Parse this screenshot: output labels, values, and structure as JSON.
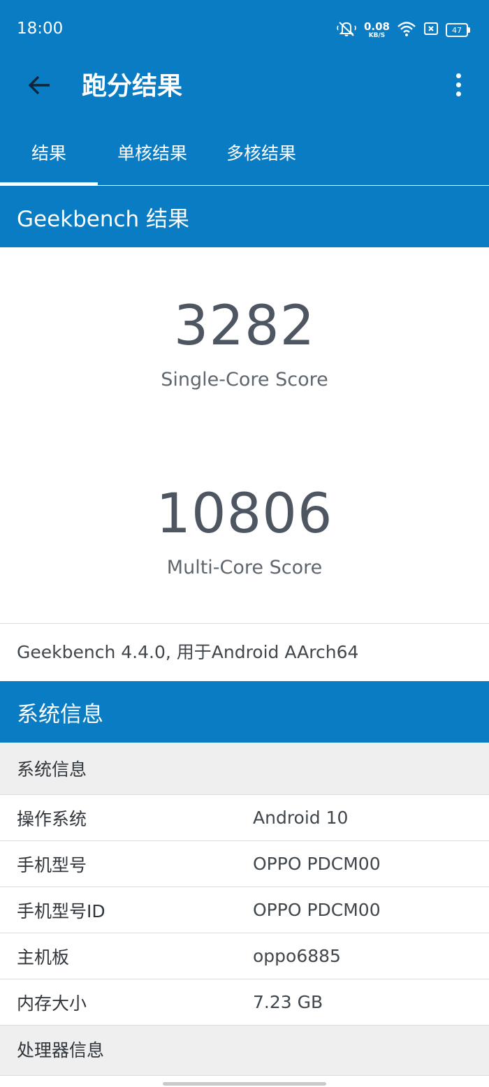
{
  "status_bar": {
    "time": "18:00",
    "net_speed_value": "0.08",
    "net_speed_unit": "KB/S",
    "battery": "47",
    "icons": [
      "mute-bell-icon",
      "wifi-icon",
      "sim-card-icon",
      "battery-icon"
    ]
  },
  "app_bar": {
    "title": "跑分结果",
    "back_icon": "back-arrow-icon",
    "menu_icon": "more-vertical-icon"
  },
  "tabs": [
    {
      "label": "结果",
      "selected": true
    },
    {
      "label": "单核结果",
      "selected": false
    },
    {
      "label": "多核结果",
      "selected": false
    }
  ],
  "geekbench": {
    "header": "Geekbench 结果",
    "single_score": "3282",
    "single_label": "Single-Core Score",
    "multi_score": "10806",
    "multi_label": "Multi-Core Score",
    "version": "Geekbench 4.4.0, 用于Android AArch64"
  },
  "system": {
    "header": "系统信息",
    "subheader": "系统信息",
    "rows": [
      {
        "key": "操作系统",
        "value": "Android 10"
      },
      {
        "key": "手机型号",
        "value": "OPPO PDCM00"
      },
      {
        "key": "手机型号ID",
        "value": "OPPO PDCM00"
      },
      {
        "key": "主机板",
        "value": "oppo6885"
      },
      {
        "key": "内存大小",
        "value": "7.23 GB"
      }
    ],
    "processor_header": "处理器信息"
  },
  "colors": {
    "primary": "#0a7cc4",
    "score_text": "#4e5661",
    "subheader_bg": "#efefef"
  }
}
